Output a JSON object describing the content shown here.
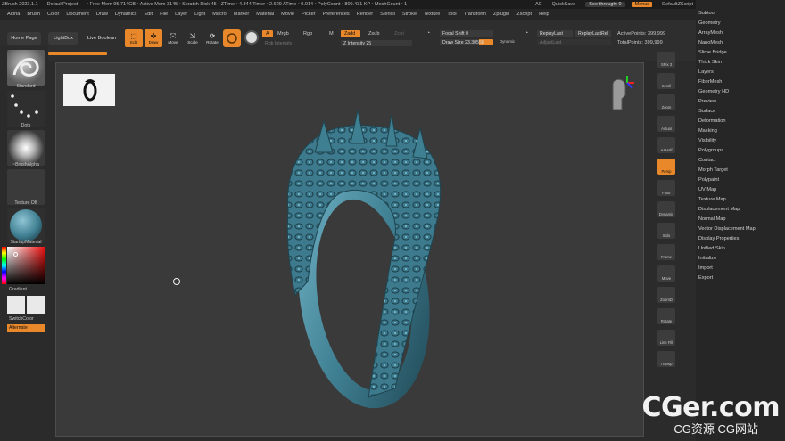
{
  "titlebar": {
    "app": "ZBrush 2023.1.1",
    "project": "DefaultProject",
    "stats": "• Free Mem 95.714GB • Active Mem 3145 • Scratch Disk 45 • ZTime • 4.344 Timer • 2.629 ATime • 0.014 • PolyCount • 800.431 KP • MeshCount • 1",
    "ac": "AC",
    "quicksave": "QuickSave",
    "seethrough": "See-through: 0",
    "menus": "Menus",
    "script": "DefaultZScript"
  },
  "menubar": [
    "Alpha",
    "Brush",
    "Color",
    "Document",
    "Draw",
    "Dynamics",
    "Edit",
    "File",
    "Layer",
    "Light",
    "Macro",
    "Marker",
    "Material",
    "Movie",
    "Picker",
    "Preferences",
    "Render",
    "Stencil",
    "Stroke",
    "Texture",
    "Tool",
    "Transform",
    "Zplugin",
    "Zscript",
    "Help"
  ],
  "shelf": {
    "home_page": "Home Page",
    "lightbox": "LightBox",
    "live_boolean": "Live Boolean",
    "tools": [
      {
        "label": "Edit",
        "icon": "edit-icon"
      },
      {
        "label": "Draw",
        "icon": "draw-icon"
      },
      {
        "label": "Move",
        "icon": "move-icon"
      },
      {
        "label": "Scale",
        "icon": "scale-icon"
      },
      {
        "label": "Rotate",
        "icon": "rotate-icon"
      }
    ],
    "a_chip": "A",
    "mrgb": "Mrgb",
    "rgb": "Rgb",
    "m": "M",
    "zadd": "Zadd",
    "zsub": "Zsub",
    "zcut": "Zcut",
    "rgb_intensity": "Rgb Intensity",
    "z_intensity": "Z Intensity 25",
    "focal_shift": "Focal Shift 0",
    "draw_size": "Draw Size 23.30558",
    "dynamic": "Dynamic",
    "replay_last": "ReplayLast",
    "replay_last_rel": "ReplayLastRel",
    "adjust_last": "AdjustLast",
    "active_points": "ActivePoints: 399,999",
    "total_points": "TotalPoints: 399,999"
  },
  "leftpanel": {
    "brush": "Standard",
    "stroke": "Dots",
    "alpha": "~BrushAlpha",
    "texture": "Texture Off",
    "material": "StartupMaterial",
    "gradient": "Gradient",
    "switch_color": "SwitchColor",
    "alternate": "Alternate"
  },
  "righttools": [
    "SPix 3",
    "Scroll",
    "Zoom",
    "Actual",
    "AAHalf",
    "Persp",
    "Floor",
    "Dynamic",
    "Solo",
    "Frame",
    "Move",
    "ZoomD",
    "Rotate",
    "Line Fill",
    "Transp"
  ],
  "rightmenu": [
    "Subtool",
    "Geometry",
    "ArrayMesh",
    "NanoMesh",
    "Slime Bridge",
    "Thick Skin",
    "Layers",
    "FiberMesh",
    "Geometry HD",
    "Preview",
    "Surface",
    "Deformation",
    "Masking",
    "Visibility",
    "Polygroups",
    "Contact",
    "Morph Target",
    "Polypaint",
    "UV Map",
    "Texture Map",
    "Displacement Map",
    "Normal Map",
    "Vector Displacement Map",
    "Display Properties",
    "Unified Skin",
    "Initialize",
    "Import",
    "Export"
  ],
  "watermark": {
    "big": "CGer.com",
    "small": "CG资源 CG网站"
  },
  "colors": {
    "accent": "#e8882a",
    "ring": "#3f7f92"
  }
}
